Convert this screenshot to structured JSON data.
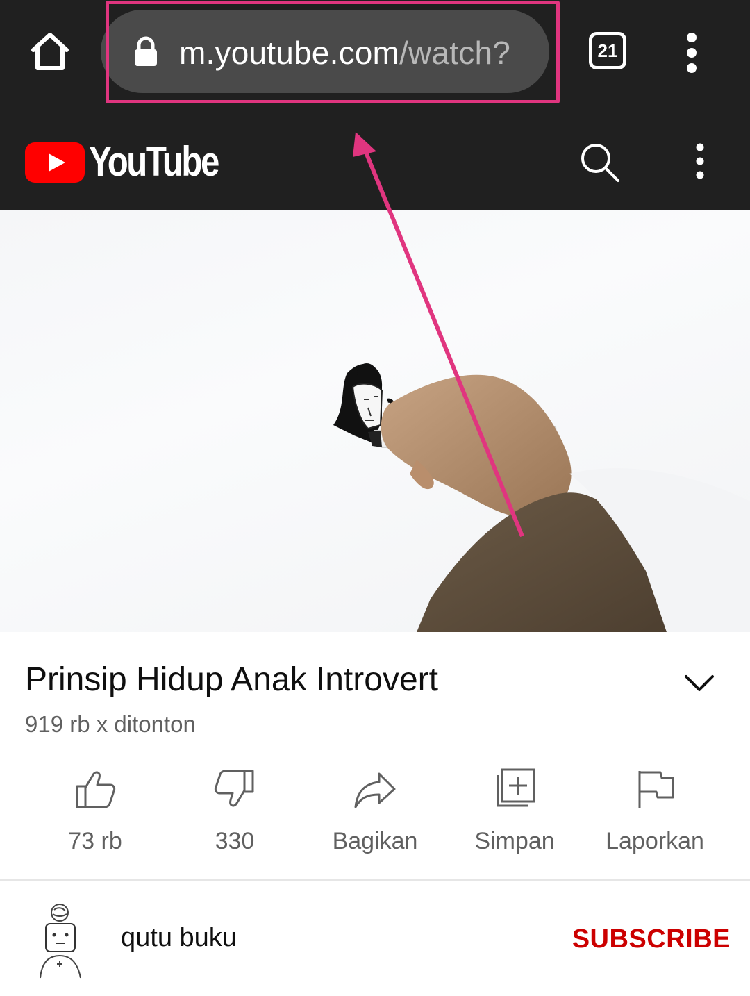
{
  "browser": {
    "url_host": "m.youtube.com",
    "url_path": "/watch?",
    "tab_count": "21",
    "highlight_color": "#e0357f"
  },
  "header": {
    "logo_text": "YouTube",
    "logo_color": "#ff0000",
    "icons": [
      "home-icon",
      "lock-icon",
      "tabs-icon",
      "more-vert-icon",
      "youtube-logo",
      "search-icon",
      "more-vert-icon"
    ]
  },
  "video": {
    "title": "Prinsip Hidup Anak Introvert",
    "views": "919 rb x ditonton"
  },
  "actions": {
    "like": "73 rb",
    "dislike": "330",
    "share": "Bagikan",
    "save": "Simpan",
    "report": "Laporkan"
  },
  "channel": {
    "name": "qutu buku",
    "subscribe_label": "SUBSCRIBE",
    "subscribe_color": "#cc0000"
  }
}
